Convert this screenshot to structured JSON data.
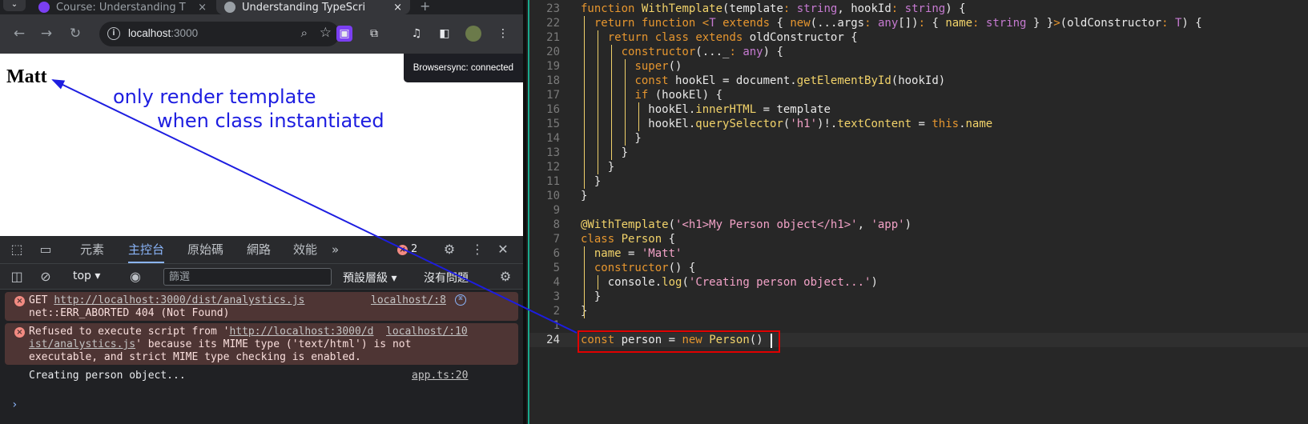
{
  "browser": {
    "tabs": [
      {
        "title": "Course: Understanding T",
        "favicon_color": "#7b3ff2",
        "active": false
      },
      {
        "title": "Understanding TypeScri",
        "favicon_color": "#9aa0a6",
        "active": true
      }
    ],
    "new_tab": "+",
    "tab_close": "×",
    "address": {
      "host": "localhost",
      "port": ":3000"
    },
    "page": {
      "heading": "Matt",
      "browsersync_notice": "Browsersync: connected"
    }
  },
  "devtools": {
    "tabs": [
      "元素",
      "主控台",
      "原始碼",
      "網路",
      "效能"
    ],
    "more": "»",
    "error_count": "2",
    "context": "top",
    "filter_placeholder": "篩選",
    "levels": "預設層級",
    "issues": "沒有問題",
    "console": [
      {
        "level": "error",
        "lines": [
          "GET ",
          "net::ERR_ABORTED 404 (Not Found)"
        ],
        "link": "http://localhost:3000/dist/analystics.js",
        "source": "localhost/:8"
      },
      {
        "level": "error",
        "line1_prefix": "Refused to execute script from '",
        "line1_link": "http://localhost:3000/d",
        "line2_link": "ist/analystics.js",
        "line2_rest": "' because its MIME type ('text/html') is not",
        "line3": "executable, and strict MIME type checking is enabled.",
        "source": "localhost/:10"
      },
      {
        "level": "log",
        "text": "Creating person object...",
        "source": "app.ts:20"
      }
    ],
    "prompt": "›"
  },
  "editor": {
    "current_line_number": "24",
    "lines": [
      {
        "n": "23",
        "html": "<span class='kw'>function</span> <span class='fn'>WithTemplate</span>(template<span class='kw'>:</span> <span class='ty'>string</span>, hookId<span class='kw'>:</span> <span class='ty'>string</span>) {"
      },
      {
        "n": "22",
        "html": "  <span class='kw'>return</span> <span class='kw'>function</span> <span class='kw'>&lt;</span><span class='ty'>T</span> <span class='kw'>extends</span> { <span class='kw'>new</span>(...args<span class='kw'>:</span> <span class='ty'>any</span>[])<span class='kw'>:</span> { <span class='pr'>name</span><span class='kw'>:</span> <span class='ty'>string</span> } }<span class='kw'>&gt;</span>(oldConstructor<span class='kw'>:</span> <span class='ty'>T</span>) {"
      },
      {
        "n": "21",
        "html": "    <span class='kw'>return</span> <span class='kw'>class</span> <span class='kw'>extends</span> oldConstructor {"
      },
      {
        "n": "20",
        "html": "      <span class='kw'>constructor</span>(..._<span class='kw'>:</span> <span class='ty'>any</span>) {"
      },
      {
        "n": "19",
        "html": "        <span class='kw'>super</span>()"
      },
      {
        "n": "18",
        "html": "        <span class='kw'>const</span> hookEl = document.<span class='fn'>getElementById</span>(hookId)"
      },
      {
        "n": "17",
        "html": "        <span class='kw'>if</span> (hookEl) {"
      },
      {
        "n": "16",
        "html": "          hookEl.<span class='pr'>innerHTML</span> = template"
      },
      {
        "n": "15",
        "html": "          hookEl.<span class='fn'>querySelector</span>(<span class='st'>'h1'</span>)!.<span class='pr'>textContent</span> = <span class='kw'>this</span>.<span class='pr'>name</span>"
      },
      {
        "n": "14",
        "html": "        }"
      },
      {
        "n": "13",
        "html": "      }"
      },
      {
        "n": "12",
        "html": "    }"
      },
      {
        "n": "11",
        "html": "  }"
      },
      {
        "n": "10",
        "html": "}"
      },
      {
        "n": "9",
        "html": ""
      },
      {
        "n": "8",
        "html": "<span class='fn'>@WithTemplate</span>(<span class='st'>'&lt;h1&gt;My Person object&lt;/h1&gt;'</span>, <span class='st'>'app'</span>)"
      },
      {
        "n": "7",
        "html": "<span class='kw'>class</span> <span class='fn'>Person</span> {"
      },
      {
        "n": "6",
        "html": "  <span class='pr'>name</span> = <span class='st'>'Matt'</span>"
      },
      {
        "n": "5",
        "html": "  <span class='kw'>constructor</span>() {"
      },
      {
        "n": "4",
        "html": "    console.<span class='fn'>log</span>(<span class='st'>'Creating person object...'</span>)"
      },
      {
        "n": "3",
        "html": "  }"
      },
      {
        "n": "2",
        "html": "}"
      },
      {
        "n": "1",
        "html": ""
      },
      {
        "n": "24",
        "html": "<span class='kw'>const</span> person = <span class='kw'>new</span> <span class='fn'>Person</span>()"
      }
    ]
  },
  "annotation": {
    "line1": "only render template",
    "line2": "when class instantiated",
    "color": "#1d1de0"
  }
}
